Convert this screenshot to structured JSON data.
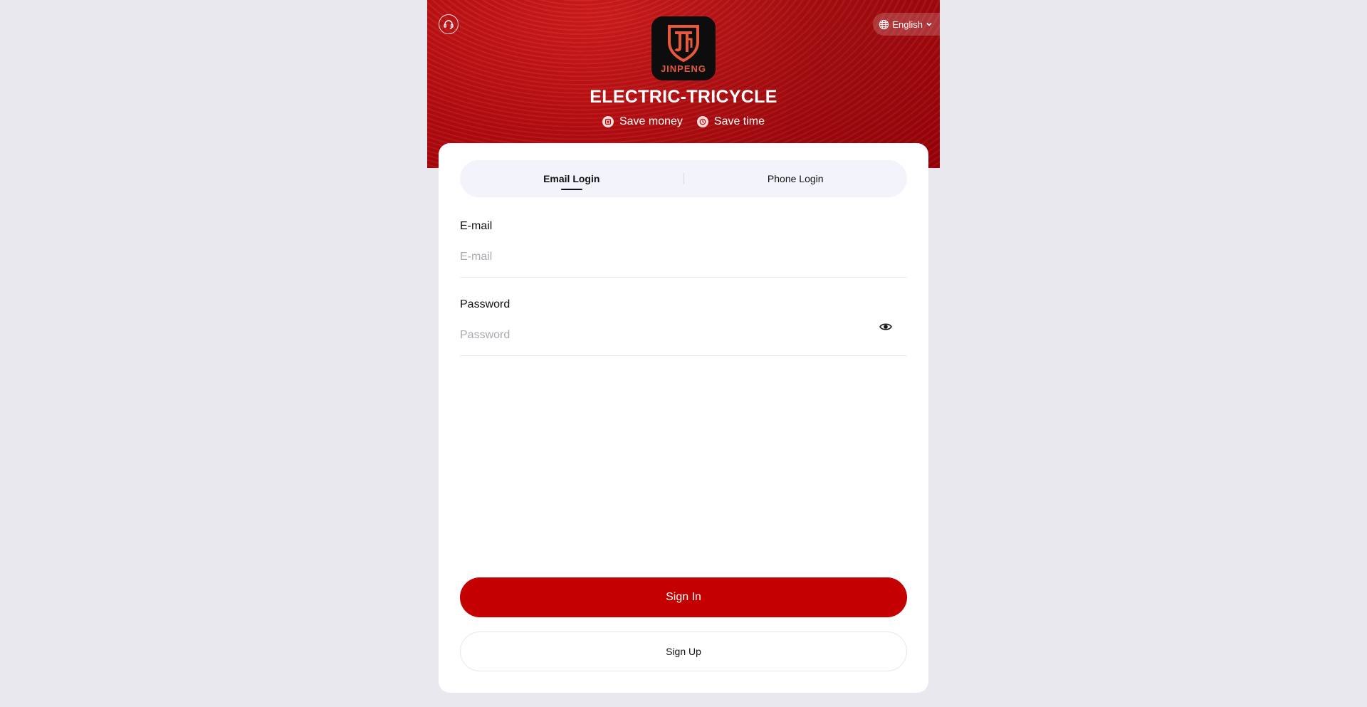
{
  "header": {
    "language": "English",
    "brand_title": "ELECTRIC-TRICYCLE",
    "logo_text": "JINPENG",
    "taglines": [
      {
        "label": "Save money",
        "icon": "coin-icon"
      },
      {
        "label": "Save time",
        "icon": "clock-icon"
      }
    ]
  },
  "login": {
    "tabs": [
      {
        "label": "Email Login",
        "active": true
      },
      {
        "label": "Phone Login",
        "active": false
      }
    ],
    "email": {
      "label": "E-mail",
      "placeholder": "E-mail",
      "value": ""
    },
    "password": {
      "label": "Password",
      "placeholder": "Password",
      "value": ""
    },
    "sign_in_label": "Sign In",
    "sign_up_label": "Sign Up"
  },
  "colors": {
    "primary": "#c50000",
    "header_red": "#b90f12",
    "background": "#e8e8ee"
  }
}
